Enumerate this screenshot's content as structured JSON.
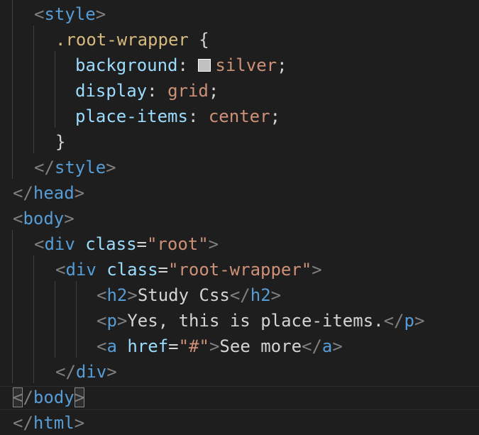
{
  "editor": {
    "lines": [
      {
        "tokens": [
          [
            "tag-punct",
            "<"
          ],
          [
            "tag",
            "style"
          ],
          [
            "tag-punct",
            ">"
          ]
        ]
      },
      {
        "tokens": [
          [
            "sel",
            ".root-wrapper"
          ],
          [
            "text",
            " "
          ],
          [
            "brace",
            "{"
          ]
        ]
      },
      {
        "tokens": [
          [
            "prop",
            "background"
          ],
          [
            "text",
            ": "
          ],
          [
            "swatch",
            ""
          ],
          [
            "val",
            "silver"
          ],
          [
            "text",
            ";"
          ]
        ]
      },
      {
        "tokens": [
          [
            "prop",
            "display"
          ],
          [
            "text",
            ": "
          ],
          [
            "val",
            "grid"
          ],
          [
            "text",
            ";"
          ]
        ]
      },
      {
        "tokens": [
          [
            "prop",
            "place-items"
          ],
          [
            "text",
            ": "
          ],
          [
            "val",
            "center"
          ],
          [
            "text",
            ";"
          ]
        ]
      },
      {
        "tokens": [
          [
            "brace",
            "}"
          ]
        ]
      },
      {
        "tokens": [
          [
            "tag-punct",
            "</"
          ],
          [
            "tag",
            "style"
          ],
          [
            "tag-punct",
            ">"
          ]
        ]
      },
      {
        "tokens": [
          [
            "tag-punct",
            "</"
          ],
          [
            "tag",
            "head"
          ],
          [
            "tag-punct",
            ">"
          ]
        ]
      },
      {
        "tokens": [
          [
            "tag-punct",
            "<"
          ],
          [
            "tag",
            "body"
          ],
          [
            "tag-punct",
            ">"
          ]
        ]
      },
      {
        "tokens": [
          [
            "tag-punct",
            "<"
          ],
          [
            "tag",
            "div"
          ],
          [
            "text",
            " "
          ],
          [
            "attr",
            "class"
          ],
          [
            "text",
            "="
          ],
          [
            "str",
            "\"root\""
          ],
          [
            "tag-punct",
            ">"
          ]
        ]
      },
      {
        "tokens": [
          [
            "tag-punct",
            "<"
          ],
          [
            "tag",
            "div"
          ],
          [
            "text",
            " "
          ],
          [
            "attr",
            "class"
          ],
          [
            "text",
            "="
          ],
          [
            "str",
            "\"root-wrapper\""
          ],
          [
            "tag-punct",
            ">"
          ]
        ]
      },
      {
        "tokens": [
          [
            "tag-punct",
            "<"
          ],
          [
            "tag",
            "h2"
          ],
          [
            "tag-punct",
            ">"
          ],
          [
            "text",
            "Study Css"
          ],
          [
            "tag-punct",
            "</"
          ],
          [
            "tag",
            "h2"
          ],
          [
            "tag-punct",
            ">"
          ]
        ]
      },
      {
        "tokens": [
          [
            "tag-punct",
            "<"
          ],
          [
            "tag",
            "p"
          ],
          [
            "tag-punct",
            ">"
          ],
          [
            "text",
            "Yes, this is place-items."
          ],
          [
            "tag-punct",
            "</"
          ],
          [
            "tag",
            "p"
          ],
          [
            "tag-punct",
            ">"
          ]
        ]
      },
      {
        "tokens": [
          [
            "tag-punct",
            "<"
          ],
          [
            "tag",
            "a"
          ],
          [
            "text",
            " "
          ],
          [
            "attr",
            "href"
          ],
          [
            "text",
            "="
          ],
          [
            "str",
            "\"#\""
          ],
          [
            "tag-punct",
            ">"
          ],
          [
            "text",
            "See more"
          ],
          [
            "tag-punct",
            "</"
          ],
          [
            "tag",
            "a"
          ],
          [
            "tag-punct",
            ">"
          ]
        ]
      },
      {
        "tokens": [
          [
            "tag-punct",
            "</"
          ],
          [
            "tag",
            "div"
          ],
          [
            "tag-punct",
            ">"
          ]
        ]
      },
      {
        "tokens": [
          [
            "match-punct",
            "<"
          ],
          [
            "tag-punct",
            "/"
          ],
          [
            "tag",
            "body"
          ],
          [
            "match-punct",
            ">"
          ]
        ]
      },
      {
        "tokens": [
          [
            "tag-punct",
            "</"
          ],
          [
            "tag",
            "html"
          ],
          [
            "tag-punct",
            ">"
          ]
        ]
      }
    ],
    "colors": {
      "background": "#1e1e1e",
      "tag": "#569cd6",
      "punctuation": "#808080",
      "attribute": "#9cdcfe",
      "string": "#ce9178",
      "selector": "#d7ba7d",
      "text": "#d4d4d4",
      "swatch_color": "#c0c0c0"
    }
  }
}
